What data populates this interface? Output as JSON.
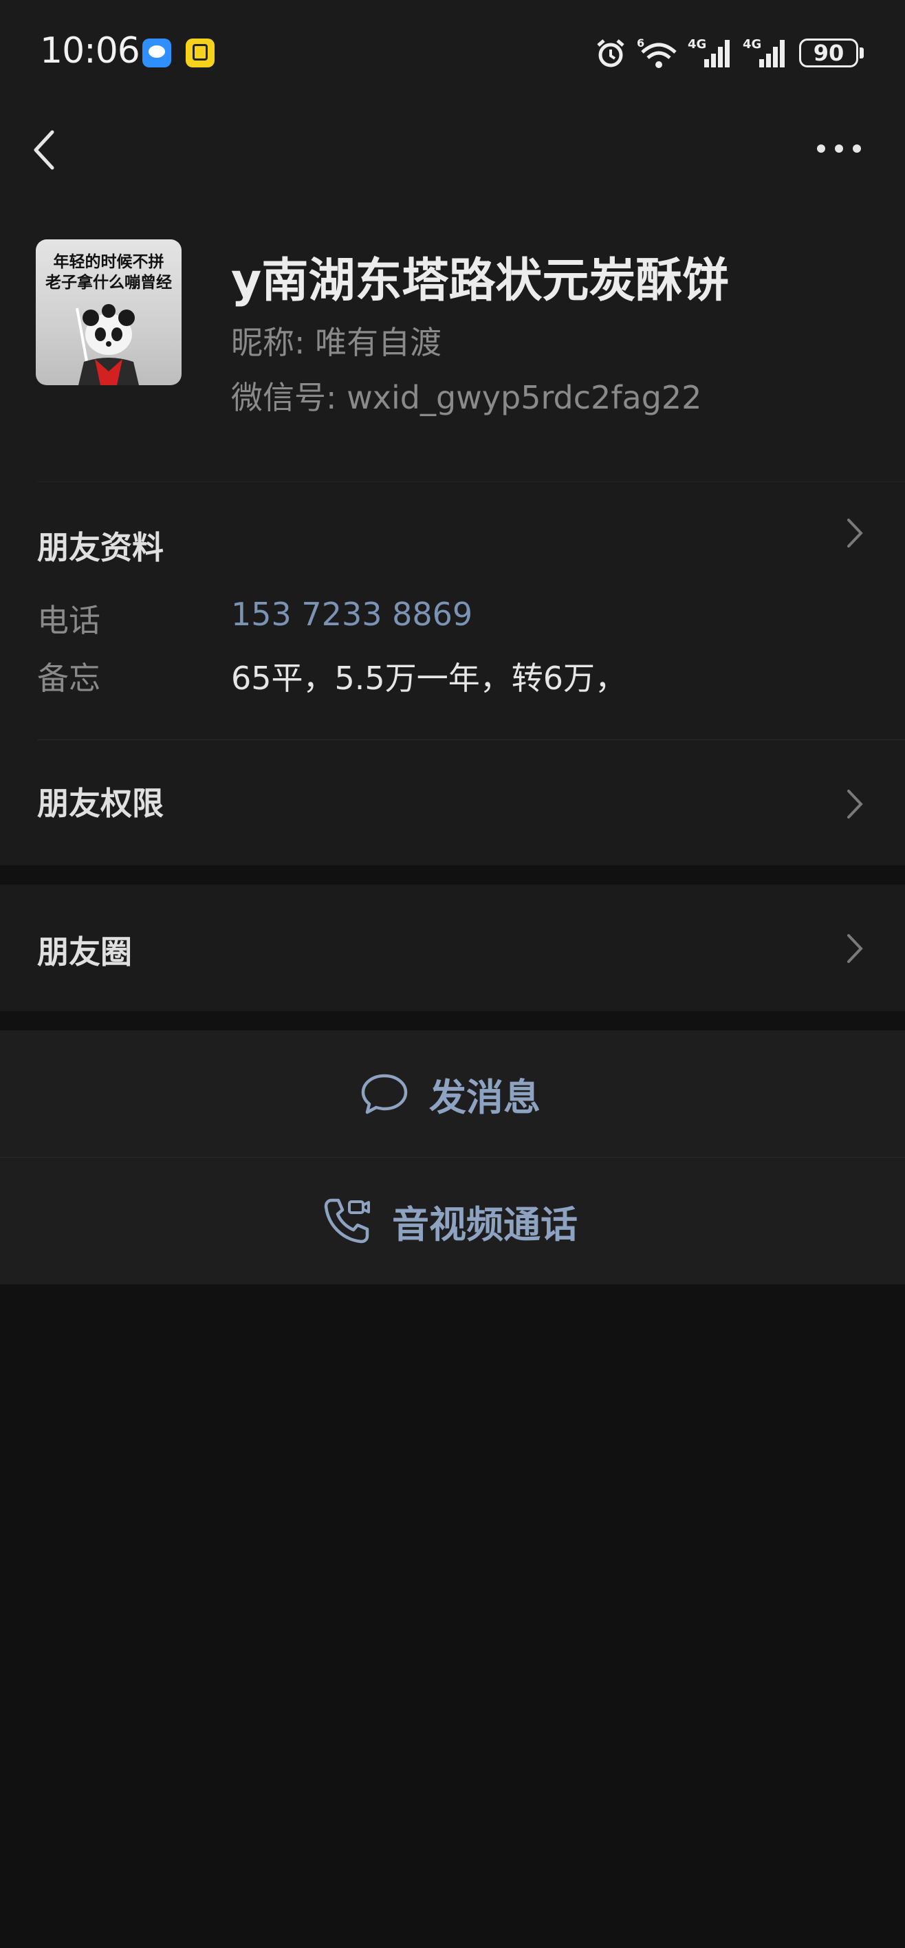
{
  "status_bar": {
    "time": "10:06",
    "battery": "90",
    "icons": [
      "message-app-icon",
      "yellow-app-icon",
      "alarm-icon",
      "wifi-icon",
      "signal-4g-icon",
      "signal-4g-icon",
      "battery-icon"
    ]
  },
  "nav": {
    "back_icon": "chevron-left-icon",
    "more_icon": "more-dots-icon"
  },
  "profile": {
    "avatar_caption_line1": "年轻的时候不拼",
    "avatar_caption_line2": "老子拿什么嘣曾经",
    "display_name": "y南湖东塔路状元炭酥饼",
    "nickname": "昵称:  唯有自渡",
    "wxid": "微信号:  wxid_gwyp5rdc2fag22"
  },
  "friend_info": {
    "title": "朋友资料",
    "phone_label": "电话",
    "phone_value": "153 7233 8869",
    "memo_label": "备忘",
    "memo_value": "65平，5.5万一年，转6万，"
  },
  "permissions": {
    "title": "朋友权限"
  },
  "moments": {
    "title": "朋友圈"
  },
  "actions": {
    "message_label": "发消息",
    "call_label": "音视频通话"
  },
  "colors": {
    "background": "#111111",
    "surface": "#1b1b1b",
    "accent": "#8ea3c2",
    "phone_link": "#7b93b4"
  }
}
